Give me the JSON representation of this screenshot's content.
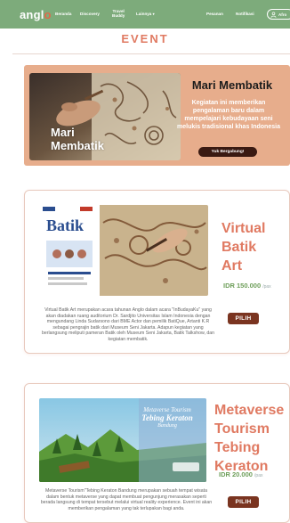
{
  "nav": {
    "logo_main": "angl",
    "logo_o": "o",
    "items": [
      "Beranda",
      "Discovery",
      "Travel",
      "Buddy",
      "Lainnya"
    ],
    "right_items": [
      "Pesanan",
      "Notifikasi"
    ],
    "profile_label": "Afro"
  },
  "page_title": "EVENT",
  "banner": {
    "image_caption_line1": "Mari",
    "image_caption_line2": "Membatik",
    "heading": "Mari Membatik",
    "description": "Kegiatan ini memberikan pengalaman baru dalam mempelajari kebudayaan seni melukis tradisional khas Indonesia",
    "button_label": "Yuk Bergabung!"
  },
  "events": [
    {
      "title_lines": [
        "Virtual",
        "Batik",
        "Art"
      ],
      "price": "IDR 150.000",
      "per": "/pax",
      "button_label": "PILIH",
      "poster_text": "Batik",
      "description": "Virtual Batik Art merupakan acara tahunan Anglo dalam acara \"InBudayaKu\" yang akan diadakan ruang auditorium Dr. Sardjito Universitas Islam Indonesia dengan mengundang Linda Sudarsono dari BME Actor dan pemilik BatiQue, Artanti K.R sebagai pengrajin batik dari Museum Seni Jakarta. Adapun kegiatan yang berlangsung meliputi pameran Batik oleh Museum Seni Jakarta, Batik Talkshow, dan kegiatan membatik."
    },
    {
      "title_lines": [
        "Metaverse",
        "Tourism",
        "Tebing",
        "Keraton"
      ],
      "price": "IDR 20.000",
      "per": "/pax",
      "button_label": "PILIH",
      "poster_text_lines": [
        "Metaverse Tourism",
        "Tebing Keraton",
        "Bandung"
      ],
      "description": "Metaverse Tourism\"Tebing Keraton Bandung merupakan sebuah tempat wisata dalam bentuk metaverse yang dapat membuat pengunjung merasakan seperti berada langsung di tempat tersebut melalui virtual reality experience. Event ini akan memberikan pengalaman yang tak terlupakan bagi anda."
    }
  ],
  "colors": {
    "nav_bg": "#7dab7b",
    "accent": "#e07a62",
    "banner_bg": "#e7ad8c",
    "button": "#7a3420",
    "price": "#6e9e5a"
  }
}
